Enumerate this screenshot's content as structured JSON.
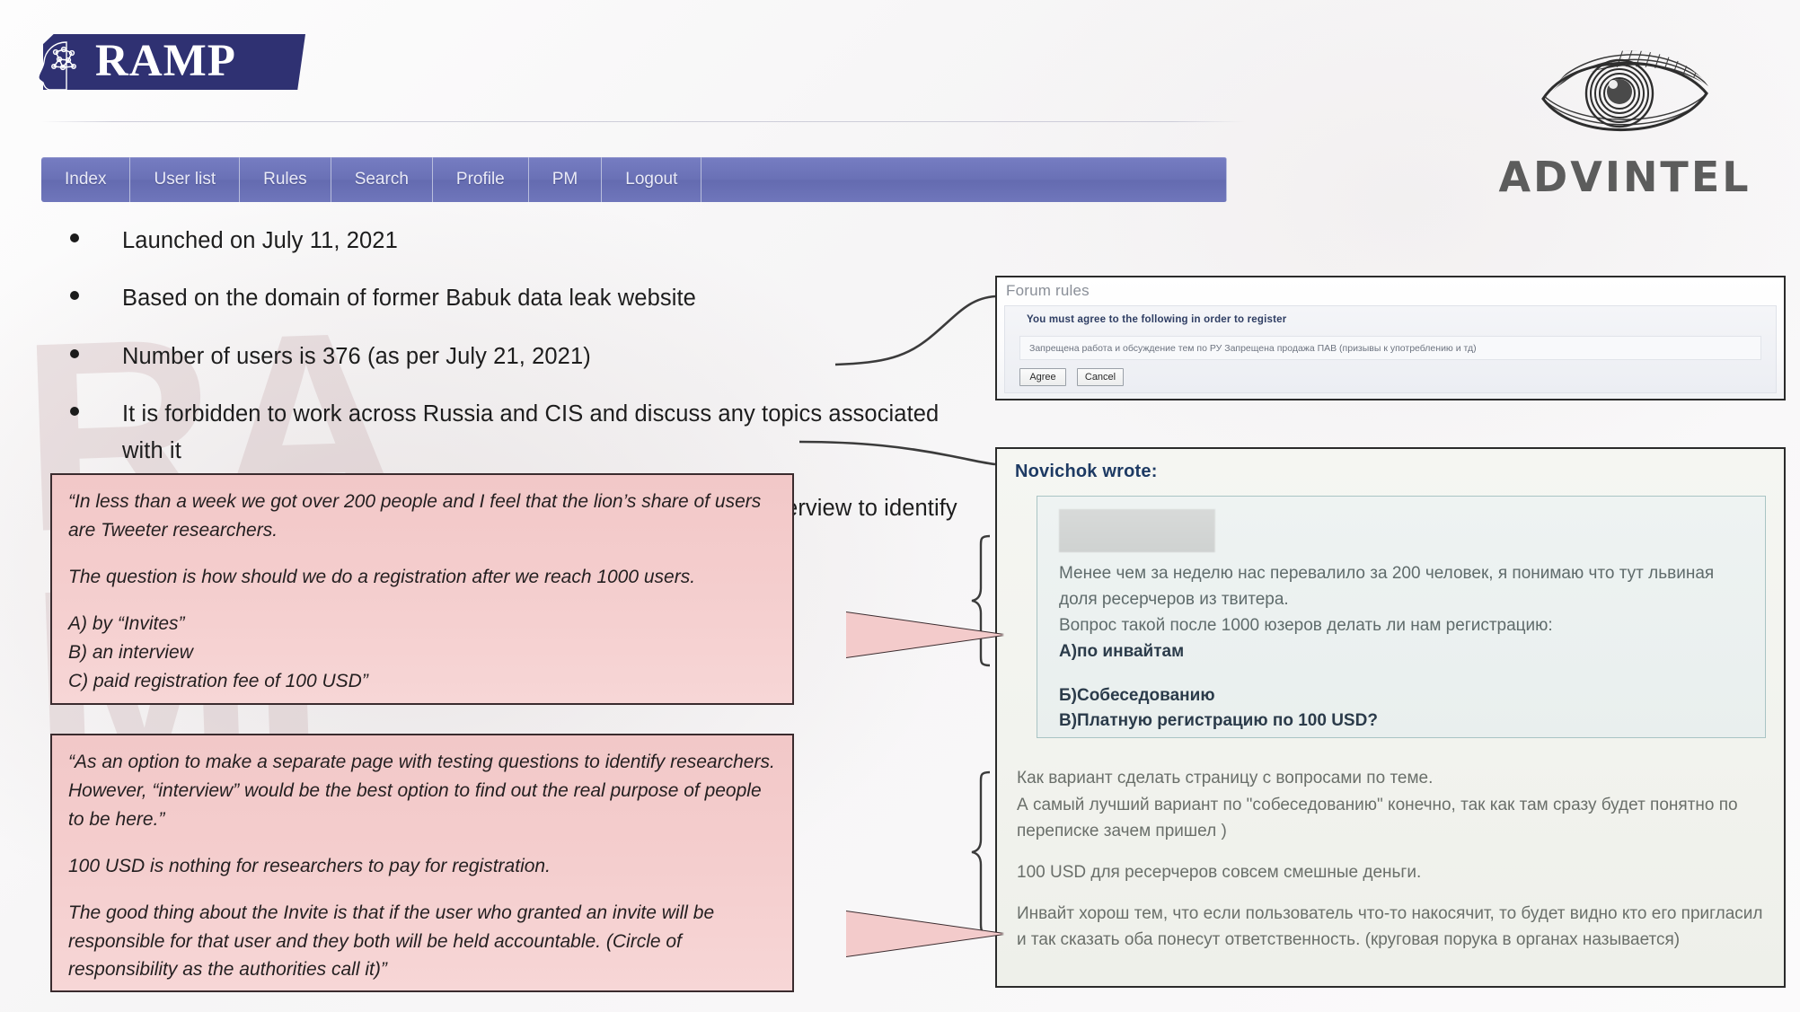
{
  "brand": {
    "logo_text": "RAMP",
    "logo_icon": "brain-head-icon"
  },
  "vendor": {
    "name": "ADVINTEL",
    "logo_icon": "eye-icon"
  },
  "forum_nav": {
    "items": [
      {
        "label": "Index"
      },
      {
        "label": "User list"
      },
      {
        "label": "Rules"
      },
      {
        "label": "Search"
      },
      {
        "label": "Profile"
      },
      {
        "label": "PM"
      },
      {
        "label": "Logout"
      }
    ]
  },
  "bullets": [
    "Launched on July 11, 2021",
    "Based on the domain of former Babuk data leak website",
    "Number of users is 376 (as per July 21, 2021)",
    "It is forbidden to work across Russia and CIS and discuss any topics associated with it",
    "Free Registration (might be switched to paid registration or an interview to identify non Russian-speaking users after reaching 1,000 users)"
  ],
  "forum_rules_panel": {
    "title": "Forum rules",
    "heading": "You must agree to the following in order to register",
    "rule_text": "Запрещена работа и обсуждение тем по РУ Запрещена продажа ПАВ (призывы к употреблению и тд)",
    "agree_button": "Agree",
    "cancel_button": "Cancel"
  },
  "post_panel": {
    "quote_label": "Novichok wrote:",
    "redacted_username": "",
    "quote_lines": [
      {
        "text": "Менее чем за неделю нас перевалило за 200 человек, я понимаю что тут львиная доля ресерчеров из твитера.",
        "bold": false
      },
      {
        "text": "Вопрос такой после 1000 юзеров делать ли нам регистрацию:",
        "bold": false
      },
      {
        "text": "А)по инвайтам",
        "bold": true
      },
      {
        "text": "",
        "bold": false
      },
      {
        "text": "Б)Собеседованию",
        "bold": true
      },
      {
        "text": "В)Платную регистрацию по 100 USD?",
        "bold": true
      }
    ],
    "reply_lines": [
      {
        "text": "Как вариант сделать страницу с вопросами по теме."
      },
      {
        "text": "А самый лучший вариант по \"собеседованию\" конечно, так как там сразу будет понятно по переписке зачем пришел )"
      },
      {
        "text": ""
      },
      {
        "text": "100 USD для ресерчеров совсем смешные деньги."
      },
      {
        "text": ""
      },
      {
        "text": "Инвайт хорош тем, что если пользователь что-то накосячит, то будет видно кто его пригласил и так сказать оба понесут ответственность. (круговая порука в органах называется)"
      }
    ]
  },
  "translations": {
    "callout_1": [
      "“In less than a week we got over 200 people and I feel that the lion’s share of users are Tweeter researchers.",
      "",
      "The question is how should we do a registration after we reach 1000 users.",
      "",
      "A) by “Invites”",
      "B) an interview",
      "C) paid registration fee of 100 USD”"
    ],
    "callout_2": [
      "“As an option to make a separate page with testing questions to identify researchers. However, “interview” would be the best option to find out the real purpose of people to be here.”",
      "",
      "100 USD is nothing for researchers to pay for registration.",
      "",
      "The good thing about the Invite is that if the user who granted an invite will be responsible for that user and they both will be held accountable. (Circle of responsibility as the authorities call it)”"
    ]
  },
  "watermark": {
    "text": "RA\nMP"
  },
  "colors": {
    "brand_navy": "#2f3172",
    "nav_blue": "#6a71b6",
    "callout_pink": "#f3cbcb",
    "quote_teal_border": "#a9c4c4",
    "post_bg": "#f2f3ee"
  }
}
